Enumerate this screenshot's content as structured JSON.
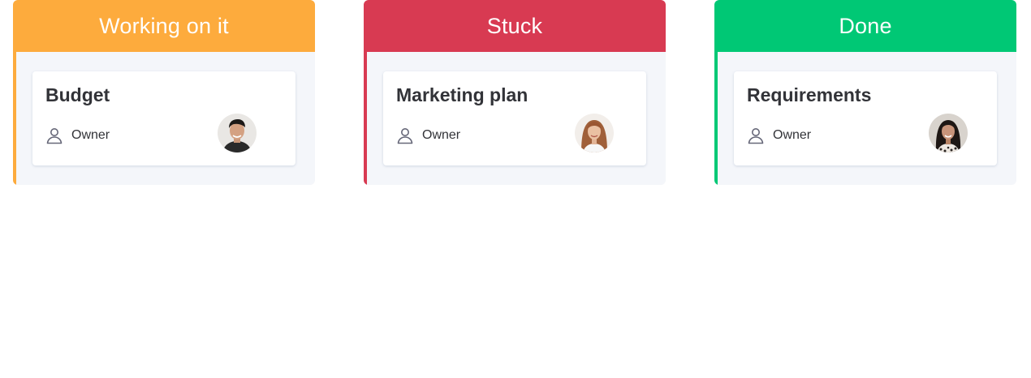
{
  "board": {
    "columns": [
      {
        "status": "Working on it",
        "color": "#fdab3d",
        "card": {
          "title": "Budget",
          "owner_label": "Owner",
          "owner_icon": "person-icon",
          "avatar": "owner-avatar"
        }
      },
      {
        "status": "Stuck",
        "color": "#d83a52",
        "card": {
          "title": "Marketing plan",
          "owner_label": "Owner",
          "owner_icon": "person-icon",
          "avatar": "owner-avatar"
        }
      },
      {
        "status": "Done",
        "color": "#00c875",
        "card": {
          "title": "Requirements",
          "owner_label": "Owner",
          "owner_icon": "person-icon",
          "avatar": "owner-avatar"
        }
      }
    ]
  }
}
